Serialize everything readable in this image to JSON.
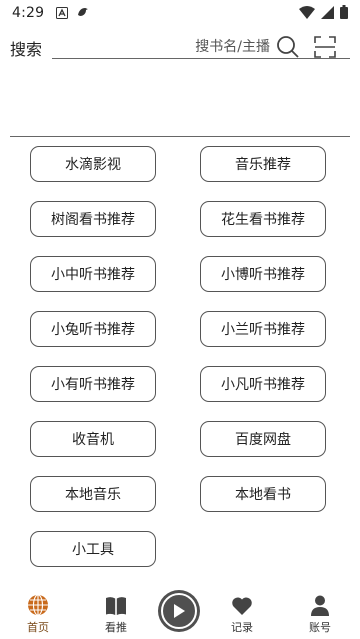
{
  "status_bar": {
    "time": "4:29",
    "icons": [
      "a-badge-icon",
      "bird-icon",
      "wifi-icon",
      "signal-icon",
      "battery-icon"
    ]
  },
  "search": {
    "label": "搜索",
    "placeholder": "搜书名/主播",
    "value": ""
  },
  "menu": [
    "水滴影视",
    "音乐推荐",
    "树阁看书推荐",
    "花生看书推荐",
    "小中听书推荐",
    "小博听书推荐",
    "小兔听书推荐",
    "小兰听书推荐",
    "小有听书推荐",
    "小凡听书推荐",
    "收音机",
    "百度网盘",
    "本地音乐",
    "本地看书",
    "小工具"
  ],
  "tabs": {
    "home": "首页",
    "read": "看推",
    "records": "记录",
    "account": "账号"
  },
  "colors": {
    "accent": "#c96a1c",
    "border": "#555555",
    "play_bg": "#505050"
  }
}
